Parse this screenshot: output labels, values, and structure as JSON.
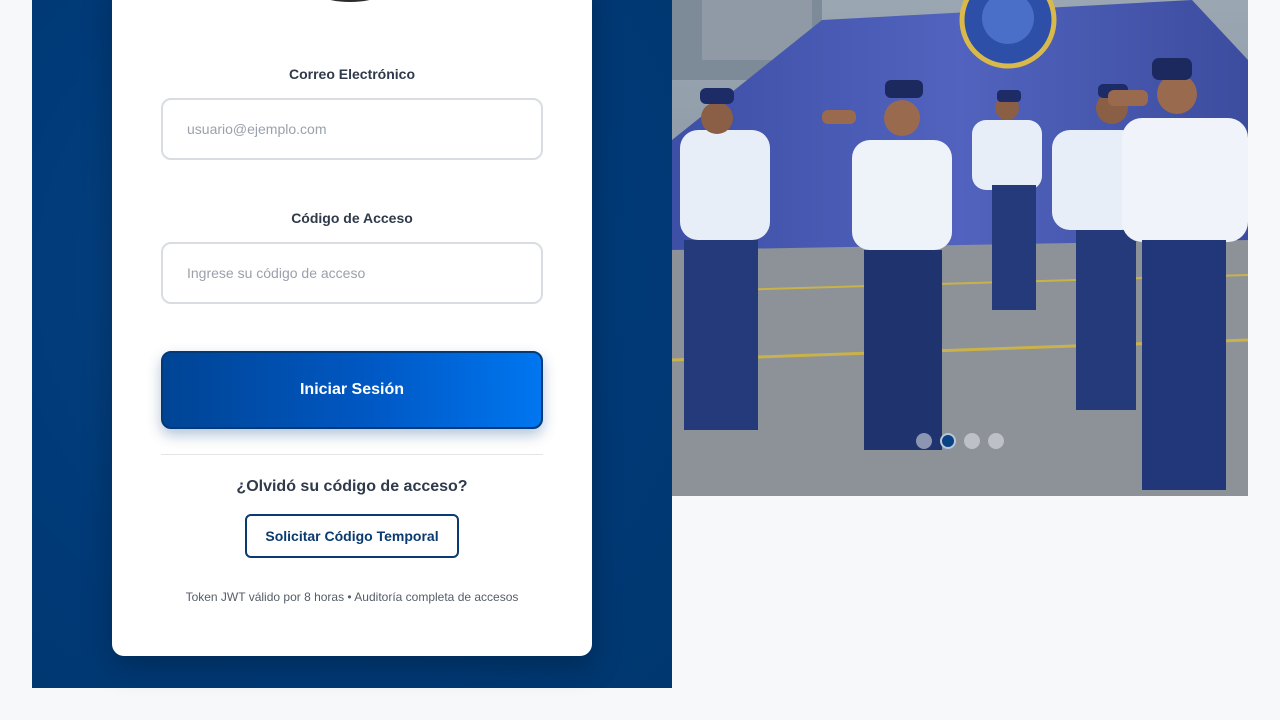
{
  "login": {
    "email_label": "Correo Electrónico",
    "email_placeholder": "usuario@ejemplo.com",
    "code_label": "Código de Acceso",
    "code_placeholder": "Ingrese su código de acceso",
    "submit_label": "Iniciar Sesión",
    "forgot_text": "¿Olvidó su código de acceso?",
    "temp_code_label": "Solicitar Código Temporal",
    "footnote": "Token JWT válido por 8 horas • Auditoría completa de accesos"
  },
  "carousel": {
    "slide_count": 4,
    "active_index": 1
  },
  "colors": {
    "brand_dark": "#003a78",
    "brand_button_start": "#004494",
    "brand_button_end": "#0076f0",
    "page_background": "#f7f8fa"
  }
}
